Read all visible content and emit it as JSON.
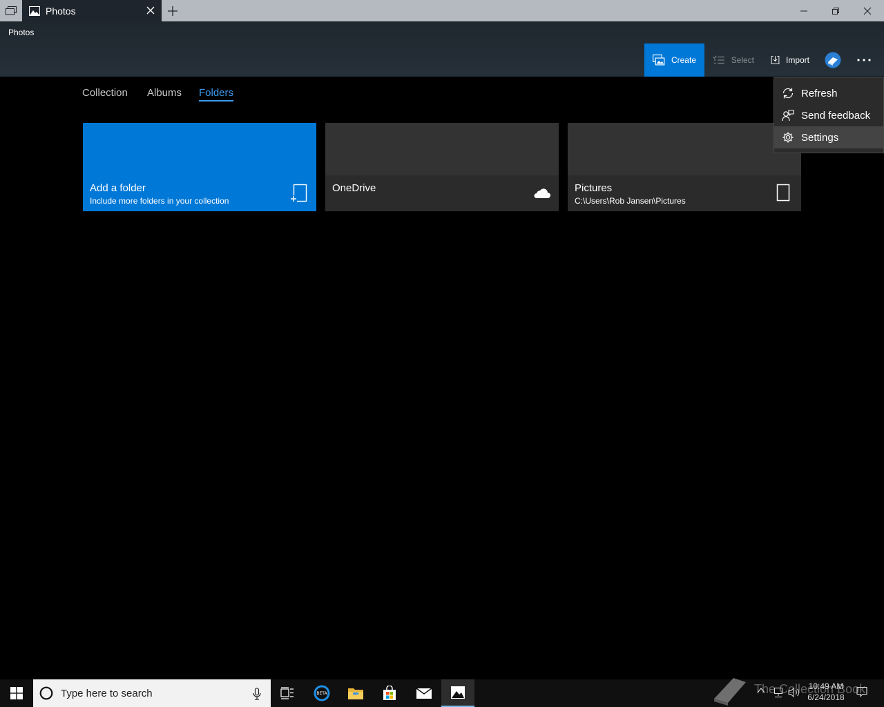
{
  "window": {
    "tab_title": "Photos",
    "app_name": "Photos"
  },
  "toolbar": {
    "create_label": "Create",
    "select_label": "Select",
    "import_label": "Import"
  },
  "nav": {
    "tabs": [
      {
        "label": "Collection",
        "active": false
      },
      {
        "label": "Albums",
        "active": false
      },
      {
        "label": "Folders",
        "active": true
      }
    ]
  },
  "tiles": [
    {
      "title": "Add a folder",
      "subtitle": "Include more folders in your collection",
      "icon": "add-folder-icon"
    },
    {
      "title": "OneDrive",
      "subtitle": "",
      "icon": "cloud-icon"
    },
    {
      "title": "Pictures",
      "subtitle": "C:\\Users\\Rob Jansen\\Pictures",
      "icon": "device-icon"
    }
  ],
  "menu": {
    "items": [
      {
        "label": "Refresh",
        "icon": "refresh-icon"
      },
      {
        "label": "Send feedback",
        "icon": "feedback-icon"
      },
      {
        "label": "Settings",
        "icon": "gear-icon",
        "highlighted": true
      }
    ]
  },
  "taskbar": {
    "search_placeholder": "Type here to search",
    "time": "10:49 AM",
    "date": "6/24/2018",
    "watermark": "The Collection Book"
  },
  "colors": {
    "accent": "#0078d7",
    "link_active": "#3d9bef",
    "tile_dark": "#333333",
    "header_bg": "#232b32"
  }
}
